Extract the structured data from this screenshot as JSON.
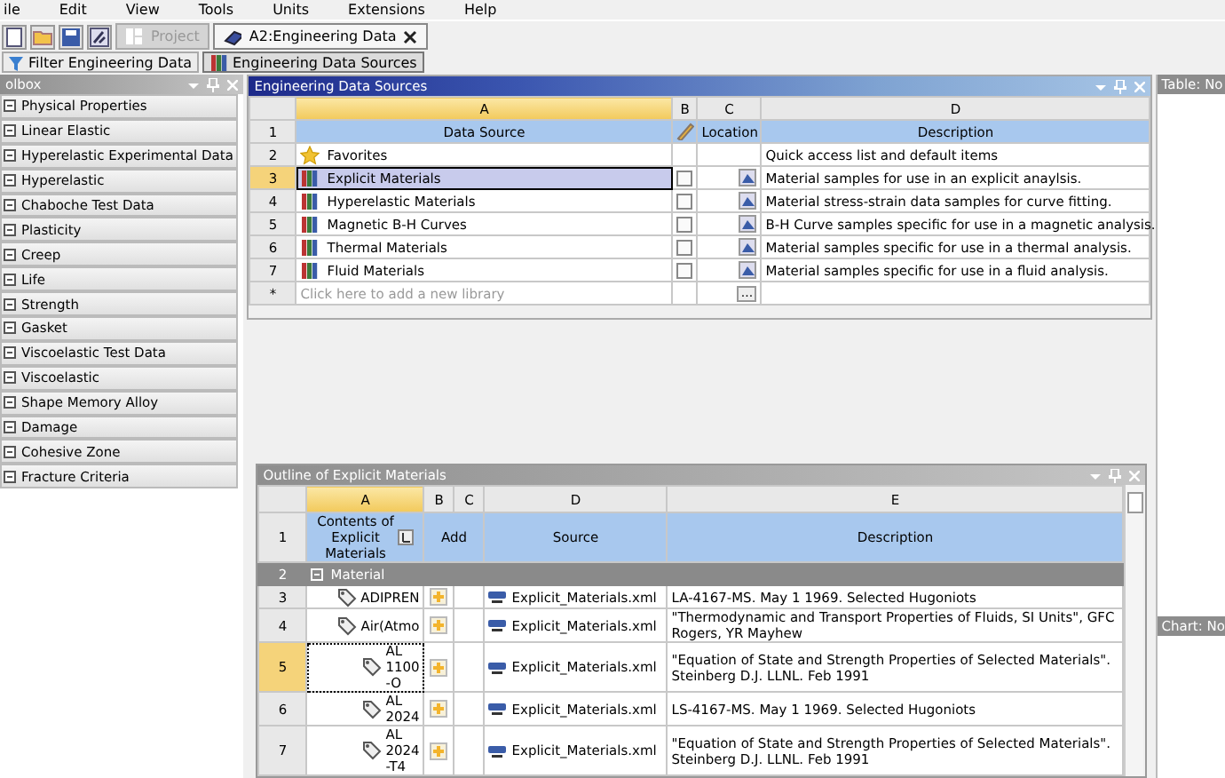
{
  "menu": [
    "ile",
    "Edit",
    "View",
    "Tools",
    "Units",
    "Extensions",
    "Help"
  ],
  "tabs": [
    {
      "label": "Project",
      "selected": false,
      "disabled": true
    },
    {
      "label": "A2:Engineering Data",
      "selected": true,
      "disabled": false
    }
  ],
  "view_buttons": [
    {
      "label": "Filter Engineering Data",
      "selected": false
    },
    {
      "label": "Engineering Data Sources",
      "selected": true
    }
  ],
  "toolbox": {
    "title": "olbox",
    "items": [
      "Physical Properties",
      "Linear Elastic",
      "Hyperelastic Experimental Data",
      "Hyperelastic",
      "Chaboche Test Data",
      "Plasticity",
      "Creep",
      "Life",
      "Strength",
      "Gasket",
      "Viscoelastic Test Data",
      "Viscoelastic",
      "Shape Memory Alloy",
      "Damage",
      "Cohesive Zone",
      "Fracture Criteria"
    ]
  },
  "sources": {
    "title": "Engineering Data Sources",
    "columns": [
      "A",
      "B",
      "C",
      "D"
    ],
    "header": {
      "num": "1",
      "data_source": "Data Source",
      "location": "Location",
      "description": "Description"
    },
    "rows": [
      {
        "num": "2",
        "kind": "favorites",
        "name": "Favorites",
        "description": "Quick access list and default items",
        "selected": false
      },
      {
        "num": "3",
        "kind": "library",
        "name": "Explicit Materials",
        "checked": false,
        "description": "Material samples for use in an explicit anaylsis.",
        "selected": true
      },
      {
        "num": "4",
        "kind": "library",
        "name": "Hyperelastic Materials",
        "checked": false,
        "description": "Material stress-strain data samples for curve fitting.",
        "selected": false
      },
      {
        "num": "5",
        "kind": "library",
        "name": "Magnetic B-H Curves",
        "checked": false,
        "description": "B-H Curve samples specific for use in a magnetic analysis.",
        "selected": false
      },
      {
        "num": "6",
        "kind": "library",
        "name": "Thermal Materials",
        "checked": false,
        "description": "Material samples specific for use in a thermal analysis.",
        "selected": false
      },
      {
        "num": "7",
        "kind": "library",
        "name": "Fluid Materials",
        "checked": false,
        "description": "Material samples specific for use in a fluid analysis.",
        "selected": false
      }
    ],
    "new_row": {
      "num": "*",
      "placeholder": "Click here to add a new library",
      "button": "..."
    }
  },
  "outline": {
    "title": "Outline of Explicit Materials",
    "columns": [
      "A",
      "B",
      "C",
      "D",
      "E"
    ],
    "header": {
      "num": "1",
      "contents": "Contents of Explicit Materials",
      "add": "Add",
      "source": "Source",
      "description": "Description"
    },
    "group": {
      "num": "2",
      "label": "Material",
      "expanded": true
    },
    "rows": [
      {
        "num": "3",
        "name": "ADIPREN",
        "source": "Explicit_Materials.xml",
        "description": "LA-4167-MS. May 1 1969. Selected Hugoniots",
        "selected": false
      },
      {
        "num": "4",
        "name": "Air(Atmo",
        "source": "Explicit_Materials.xml",
        "description": "\"Thermodynamic and Transport Properties of Fluids, SI Units\", GFC Rogers, YR Mayhew",
        "selected": false
      },
      {
        "num": "5",
        "name": "AL 1100 -O",
        "source": "Explicit_Materials.xml",
        "description": "\"Equation of State and Strength Properties of Selected Materials\". Steinberg D.J. LLNL. Feb 1991",
        "selected": true
      },
      {
        "num": "6",
        "name": "AL 2024",
        "source": "Explicit_Materials.xml",
        "description": "LS-4167-MS. May 1 1969. Selected Hugoniots",
        "selected": false
      },
      {
        "num": "7",
        "name": "AL 2024 -T4",
        "source": "Explicit_Materials.xml",
        "description": "\"Equation of State and Strength Properties of Selected Materials\". Steinberg D.J. LLNL. Feb 1991",
        "selected": false
      }
    ]
  },
  "side": {
    "table_title": "Table: No",
    "chart_title": "Chart: No"
  }
}
